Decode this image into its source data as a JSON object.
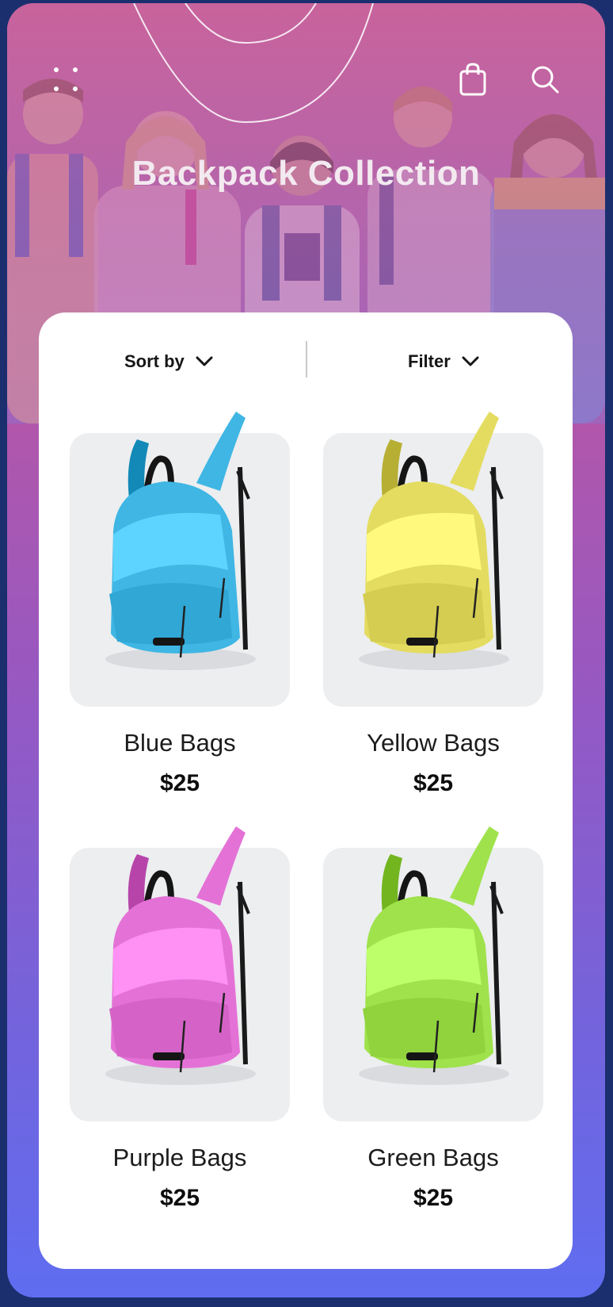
{
  "header": {
    "title": "Backpack Collection",
    "menu_icon": "dots-menu-icon",
    "bag_icon": "shopping-bag-icon",
    "search_icon": "search-icon"
  },
  "toolbar": {
    "sort_label": "Sort by",
    "filter_label": "Filter"
  },
  "products": [
    {
      "name": "Blue Bags",
      "price": "$25",
      "color": "#3fb6e4"
    },
    {
      "name": "Yellow Bags",
      "price": "$25",
      "color": "#e4dc60"
    },
    {
      "name": "Purple Bags",
      "price": "$25",
      "color": "#e472d6"
    },
    {
      "name": "Green Bags",
      "price": "$25",
      "color": "#9fe24c"
    }
  ],
  "colors": {
    "background_top": "#c4518f",
    "background_bottom": "#5f6df0",
    "frame": "#1b2f6e",
    "card": "#ffffff",
    "thumb_bg": "#eceef0"
  }
}
